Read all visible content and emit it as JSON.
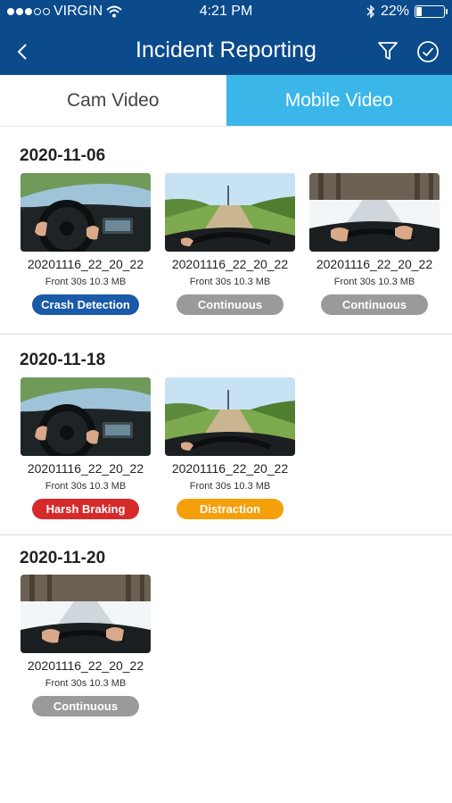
{
  "status_bar": {
    "carrier": "VIRGIN",
    "time": "4:21 PM",
    "battery": "22%",
    "battery_level": 0.22
  },
  "nav": {
    "title": "Incident Reporting",
    "icons": [
      "back-chevron-icon",
      "filter-icon",
      "check-circle-icon"
    ]
  },
  "tabs": [
    {
      "label": "Cam Video",
      "active": false
    },
    {
      "label": "Mobile Video",
      "active": true
    }
  ],
  "colors": {
    "nav_bg": "#0b4a8b",
    "tab_active": "#3ab7e8",
    "badge_crash": "#1a5aa8",
    "badge_continuous": "#9a9a9a",
    "badge_harsh": "#d62a2a",
    "badge_distraction": "#f5a00a"
  },
  "sections": [
    {
      "date": "2020-11-06",
      "items": [
        {
          "filename": "20201116_22_20_22",
          "meta": "Front 30s 10.3 MB",
          "tag": "Crash Detection",
          "scene": "cockpit"
        },
        {
          "filename": "20201116_22_20_22",
          "meta": "Front 30s 10.3 MB",
          "tag": "Continuous",
          "scene": "road"
        },
        {
          "filename": "20201116_22_20_22",
          "meta": "Front 30s 10.3 MB",
          "tag": "Continuous",
          "scene": "snow"
        }
      ]
    },
    {
      "date": "2020-11-18",
      "items": [
        {
          "filename": "20201116_22_20_22",
          "meta": "Front 30s 10.3 MB",
          "tag": "Harsh Braking",
          "scene": "cockpit"
        },
        {
          "filename": "20201116_22_20_22",
          "meta": "Front 30s 10.3 MB",
          "tag": "Distraction",
          "scene": "road"
        }
      ]
    },
    {
      "date": "2020-11-20",
      "items": [
        {
          "filename": "20201116_22_20_22",
          "meta": "Front 30s 10.3 MB",
          "tag": "Continuous",
          "scene": "snow"
        }
      ]
    }
  ]
}
